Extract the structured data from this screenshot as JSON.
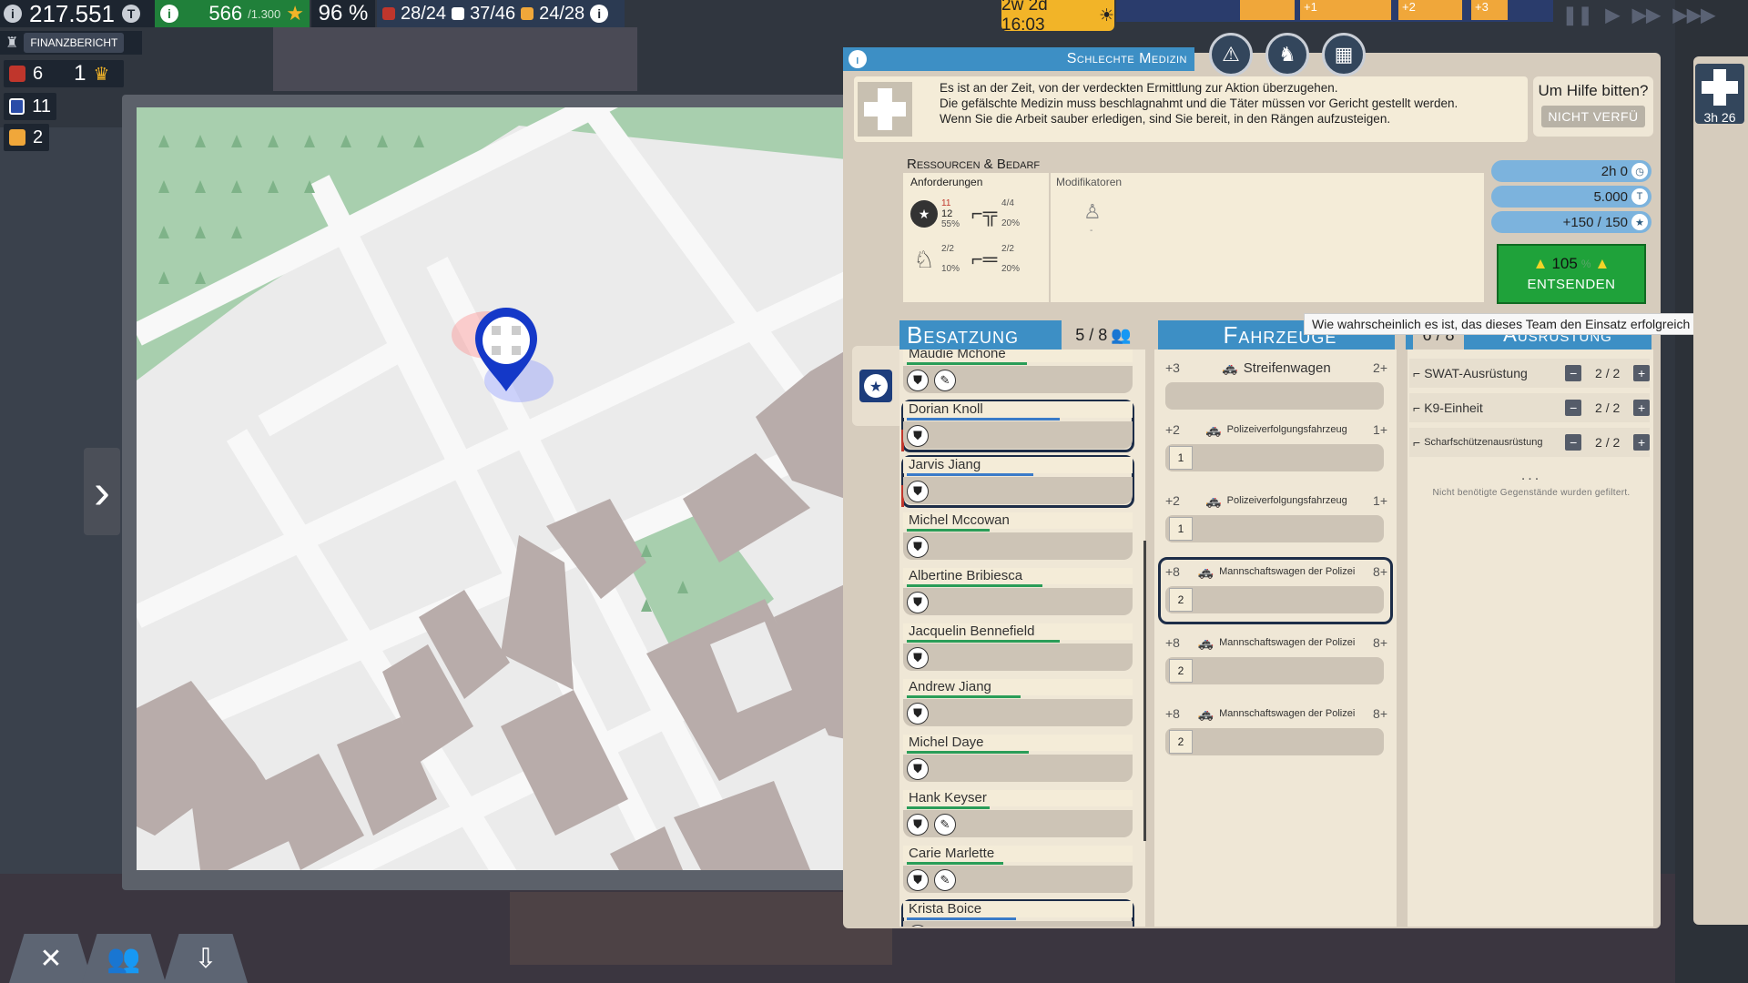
{
  "hud": {
    "money": "217.551",
    "money_icon": "coin-icon",
    "reputation": "566",
    "reputation_max": "/1.300",
    "percent": "96 %",
    "fire_units": "28/24",
    "police_units": "37/46",
    "medic_units": "24/28"
  },
  "time": {
    "clock": "2w 2d 16:03",
    "timeline_markers": [
      "+1",
      "+2",
      "+3"
    ]
  },
  "left": {
    "finance_label": "FINANZBERICHT",
    "stat_fire": "6",
    "stat_level": "1",
    "stat_police": "11",
    "stat_medic": "2"
  },
  "mission": {
    "title": "Schlechte Medizin",
    "description": [
      "Es ist an der Zeit, von der verdeckten Ermittlung zur Aktion überzugehen.",
      "Die gefälschte Medizin muss beschlagnahmt und die Täter müssen vor Gericht gestellt werden.",
      "Wenn Sie die Arbeit sauber erledigen, sind Sie bereit, in den Rängen aufzusteigen."
    ],
    "help_question": "Um Hilfe bitten?",
    "help_button": "NICHT VERFÜ"
  },
  "resources": {
    "title": "Ressourcen & Bedarf",
    "requirements_title": "Anforderungen",
    "modifiers_title": "Modifikatoren",
    "req": [
      {
        "icon": "police-badge-icon",
        "top": "11",
        "bottom": "12",
        "pct": "55%"
      },
      {
        "icon": "rifle-icon",
        "top": "4",
        "bottom": "4",
        "pct": "20%"
      },
      {
        "icon": "k9-icon",
        "top": "2",
        "bottom": "2",
        "pct": "10%"
      },
      {
        "icon": "sniper-icon",
        "top": "2",
        "bottom": "2",
        "pct": "20%"
      }
    ],
    "modifier_dash": "-",
    "duration": "2h 0",
    "cost": "5.000",
    "reward": "+150 / 150",
    "success_value": "105",
    "success_unit": "%",
    "dispatch_label": "ENTSENDEN",
    "tooltip": "Wie wahrscheinlich es ist, das dieses Team den Einsatz erfolgreich beendet."
  },
  "crew": {
    "title": "Besatzung",
    "count": "5 / 8",
    "members": [
      {
        "name": "Maudie Mchone",
        "fill": 0.55,
        "extra": true,
        "sel": false
      },
      {
        "name": "Dorian Knoll",
        "fill": 0.7,
        "extra": false,
        "sel": true
      },
      {
        "name": "Jarvis Jiang",
        "fill": 0.58,
        "extra": false,
        "sel": true
      },
      {
        "name": "Michel Mccowan",
        "fill": 0.38,
        "extra": false,
        "sel": false
      },
      {
        "name": "Albertine Bribiesca",
        "fill": 0.62,
        "extra": false,
        "sel": false
      },
      {
        "name": "Jacquelin Bennefield",
        "fill": 0.7,
        "extra": false,
        "sel": false
      },
      {
        "name": "Andrew Jiang",
        "fill": 0.52,
        "extra": false,
        "sel": false
      },
      {
        "name": "Michel Daye",
        "fill": 0.56,
        "extra": false,
        "sel": false
      },
      {
        "name": "Hank Keyser",
        "fill": 0.38,
        "extra": true,
        "sel": false
      },
      {
        "name": "Carie Marlette",
        "fill": 0.44,
        "extra": true,
        "sel": false
      },
      {
        "name": "Krista Boice",
        "fill": 0.5,
        "extra": false,
        "sel": true
      }
    ]
  },
  "vehicles": {
    "title": "Fahrzeuge",
    "items": [
      {
        "left": "+3",
        "name": "Streifenwagen",
        "right": "2+",
        "slot": "",
        "sel": false
      },
      {
        "left": "+2",
        "name": "Polizeiverfolgungsfahrzeug",
        "right": "1+",
        "slot": "1",
        "sel": false
      },
      {
        "left": "+2",
        "name": "Polizeiverfolgungsfahrzeug",
        "right": "1+",
        "slot": "1",
        "sel": false
      },
      {
        "left": "+8",
        "name": "Mannschaftswagen der Polizei",
        "right": "8+",
        "slot": "2",
        "sel": true
      },
      {
        "left": "+8",
        "name": "Mannschaftswagen der Polizei",
        "right": "8+",
        "slot": "2",
        "sel": false
      },
      {
        "left": "+8",
        "name": "Mannschaftswagen der Polizei",
        "right": "8+",
        "slot": "2",
        "sel": false
      }
    ]
  },
  "equipment": {
    "title": "Ausrüstung",
    "count": "6 / 8",
    "items": [
      {
        "name": "SWAT-Ausrüstung",
        "count": "2 / 2"
      },
      {
        "name": "K9-Einheit",
        "count": "2 / 2"
      },
      {
        "name": "Scharfschützenausrüstung",
        "count": "2 / 2"
      }
    ],
    "dots": "...",
    "note": "Nicht benötigte Gegenstände wurden gefiltert."
  },
  "right": {
    "timer": "3h 26"
  },
  "colors": {
    "panel_blue": "#3d8fc5",
    "dispatch_green": "#1fa23a",
    "map_building": "#b8acaa",
    "map_park": "#a8cfae"
  }
}
